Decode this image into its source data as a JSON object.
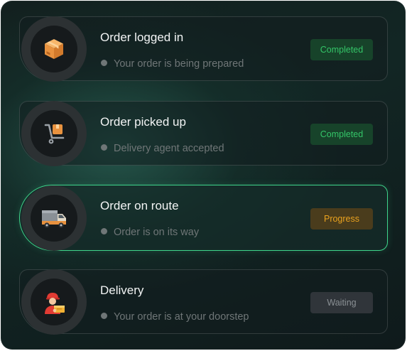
{
  "steps": [
    {
      "title": "Order logged in",
      "subtitle": "Your order is being prepared",
      "status": "Completed",
      "icon": "package-box-icon"
    },
    {
      "title": "Order picked up",
      "subtitle": "Delivery agent accepted",
      "status": "Completed",
      "icon": "hand-truck-icon"
    },
    {
      "title": "Order on route",
      "subtitle": "Order is on its way",
      "status": "Progress",
      "icon": "delivery-truck-icon"
    },
    {
      "title": "Delivery",
      "subtitle": "Your order is at your doorstep",
      "status": "Waiting",
      "icon": "courier-icon"
    }
  ],
  "colors": {
    "active_border": "#3fd58b",
    "completed_text": "#34c568",
    "completed_bg": "#17432a",
    "progress_text": "#e9a21f",
    "progress_bg": "#4a3c1c",
    "waiting_text": "#8a9094",
    "waiting_bg": "#30353a"
  }
}
